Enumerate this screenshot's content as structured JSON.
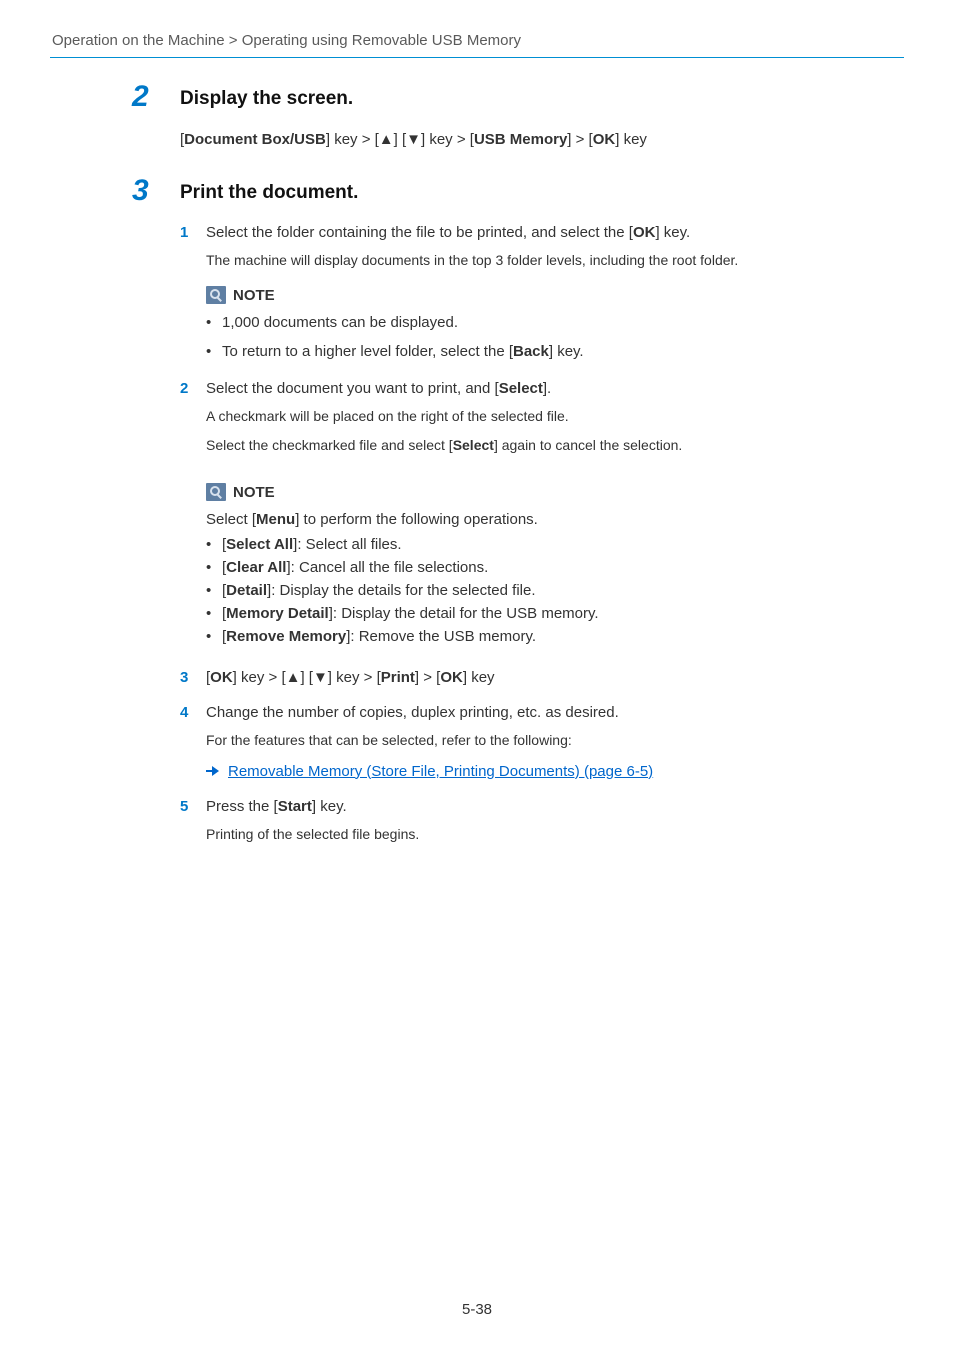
{
  "breadcrumb": "Operation on the Machine > Operating using Removable USB Memory",
  "step2": {
    "num": "2",
    "title": "Display the screen.",
    "seq_parts": [
      "[",
      "Document Box/USB",
      "] key > [▲] [▼] key > [",
      "USB Memory",
      "] > [",
      "OK",
      "] key"
    ]
  },
  "step3": {
    "num": "3",
    "title": "Print the document.",
    "sub1": {
      "num": "1",
      "text_parts": [
        "Select the folder containing the file to be printed, and select the [",
        "OK",
        "] key."
      ],
      "desc": "The machine will display documents in the top 3 folder levels, including the root folder."
    },
    "note1": {
      "label": "NOTE",
      "l1": "1,000 documents can be displayed.",
      "l2_parts": [
        "To return to a higher level folder, select the [",
        "Back",
        "] key."
      ]
    },
    "sub2": {
      "num": "2",
      "text_parts": [
        "Select the document you want to print, and [",
        "Select",
        "]."
      ],
      "desc1": "A checkmark will be placed on the right of the selected file.",
      "desc2_parts": [
        "Select the checkmarked file and select [",
        "Select",
        "] again to cancel the selection."
      ]
    },
    "note2": {
      "label": "NOTE",
      "intro_parts": [
        "Select [",
        "Menu",
        "] to perform the following operations."
      ],
      "items": [
        {
          "b": "Select All",
          "rest": "]: Select all files."
        },
        {
          "b": "Clear All",
          "rest": "]: Cancel all the file selections."
        },
        {
          "b": "Detail",
          "rest": "]: Display the details for the selected file."
        },
        {
          "b": "Memory Detail",
          "rest": "]: Display the detail for the USB memory."
        },
        {
          "b": "Remove Memory",
          "rest": "]: Remove the USB memory."
        }
      ]
    },
    "sub3": {
      "num": "3",
      "text_parts": [
        "[",
        "OK",
        "] key > [▲] [▼] key > [",
        "Print",
        "] > [",
        "OK",
        "] key"
      ]
    },
    "sub4": {
      "num": "4",
      "text": "Change the number of copies, duplex printing, etc. as desired.",
      "desc": "For the features that can be selected, refer to the following:",
      "link": "Removable Memory (Store File, Printing Documents) (page 6-5)"
    },
    "sub5": {
      "num": "5",
      "text_parts": [
        "Press the [",
        "Start",
        "] key."
      ],
      "desc": "Printing of the selected file begins."
    }
  },
  "page_number": "5-38"
}
